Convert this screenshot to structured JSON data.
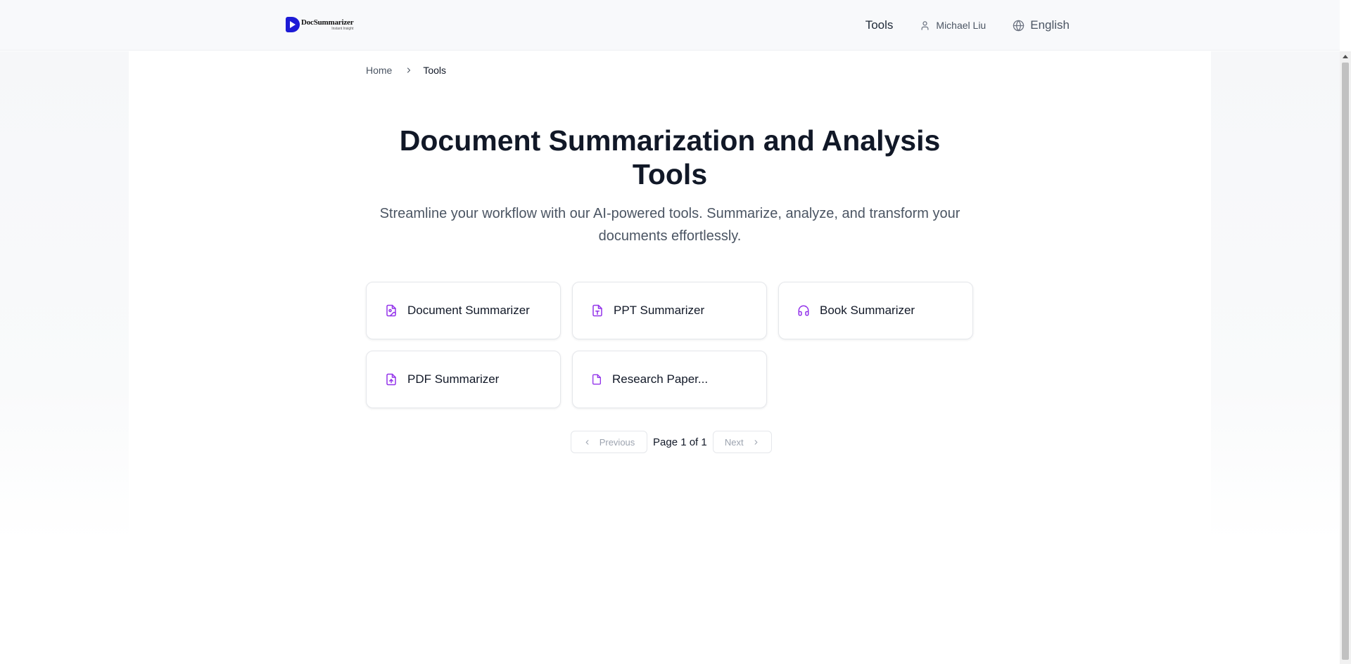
{
  "header": {
    "logo": {
      "name": "DocSummarizer",
      "tagline": "Instant Insight",
      "icon": "play-icon"
    },
    "nav": {
      "tools_label": "Tools",
      "user_name": "Michael Liu",
      "user_icon": "user-icon",
      "language_label": "English",
      "language_icon": "globe-icon"
    }
  },
  "breadcrumb": {
    "home": "Home",
    "separator_icon": "chevron-right-icon",
    "current": "Tools"
  },
  "hero": {
    "title": "Document Summarization and Analysis Tools",
    "subtitle": "Streamline your workflow with our AI-powered tools. Summarize, analyze, and transform your documents effortlessly."
  },
  "tools": [
    {
      "label": "Document Summarizer",
      "icon": "file-image-icon"
    },
    {
      "label": "PPT Summarizer",
      "icon": "file-type-icon"
    },
    {
      "label": "Book Summarizer",
      "icon": "headphones-icon"
    },
    {
      "label": "PDF Summarizer",
      "icon": "file-upload-icon"
    },
    {
      "label": "Research Paper...",
      "icon": "file-icon"
    }
  ],
  "pagination": {
    "previous_label": "Previous",
    "next_label": "Next",
    "page_info": "Page 1 of 1"
  },
  "colors": {
    "accent": "#9333ea",
    "brand": "#1d1bd6",
    "text": "#111827",
    "muted": "#4b5563"
  }
}
